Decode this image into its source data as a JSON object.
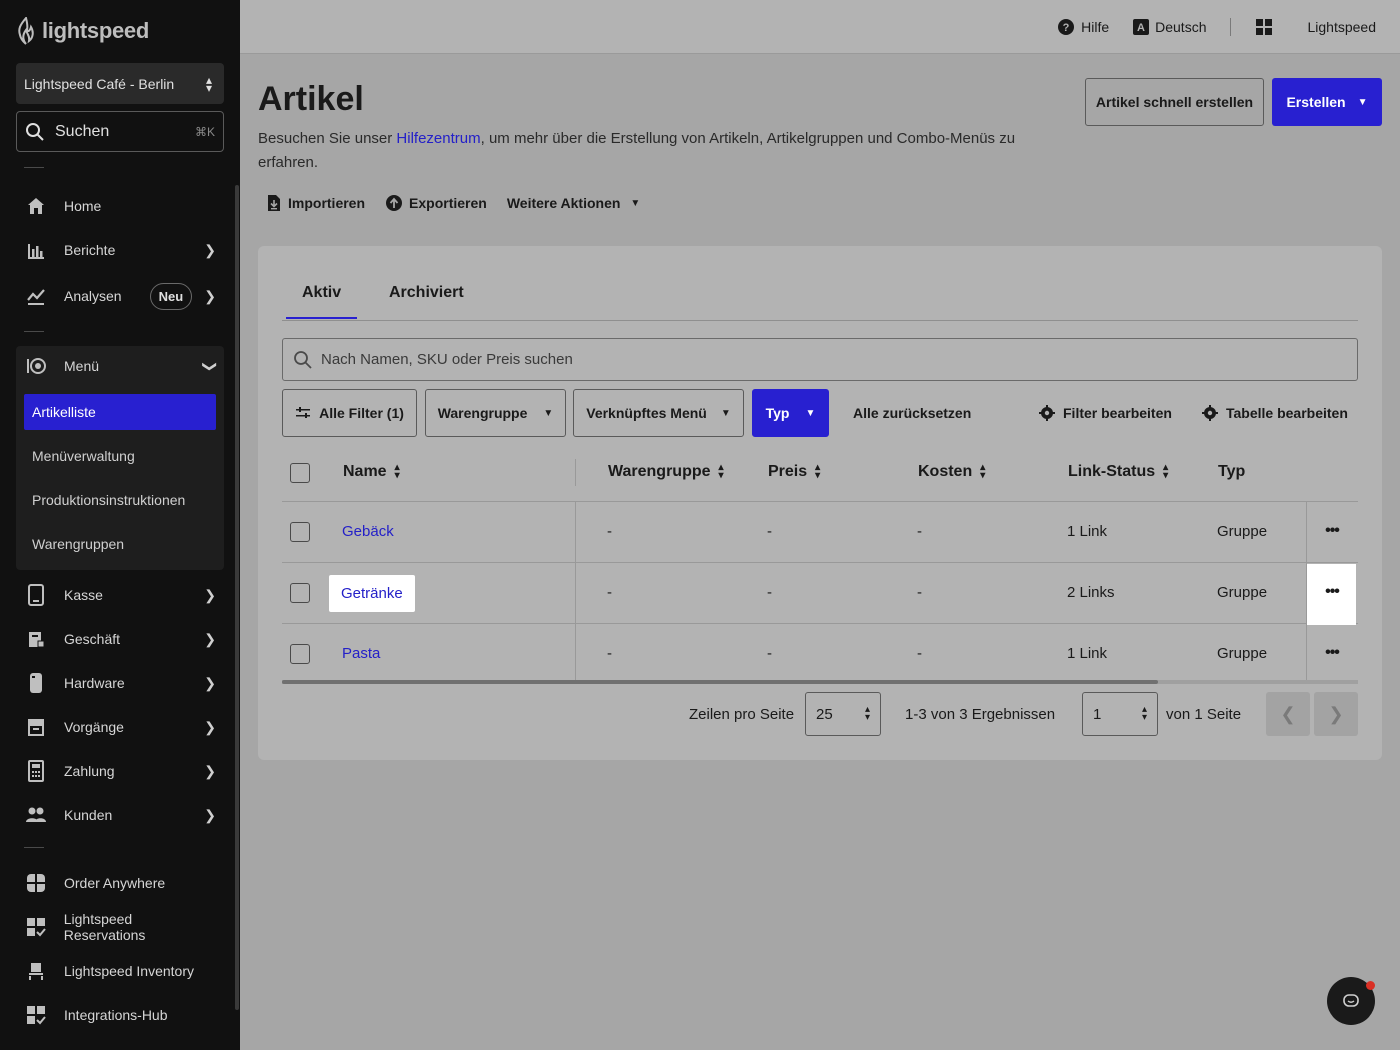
{
  "sidebar": {
    "logo": "lightspeed",
    "venue": "Lightspeed Café - Berlin",
    "search_label": "Suchen",
    "search_shortcut": "⌘K",
    "nav": {
      "home": "Home",
      "berichte": "Berichte",
      "analysen": "Analysen",
      "analysen_badge": "Neu",
      "menu": "Menü",
      "kasse": "Kasse",
      "geschaeft": "Geschäft",
      "hardware": "Hardware",
      "vorgaenge": "Vorgänge",
      "zahlung": "Zahlung",
      "kunden": "Kunden",
      "order_anywhere": "Order Anywhere",
      "reservations": "Lightspeed Reservations",
      "inventory": "Lightspeed Inventory",
      "integrations": "Integrations-Hub"
    },
    "menu_sub": [
      "Artikelliste",
      "Menüverwaltung",
      "Produktionsinstruktionen",
      "Warengruppen"
    ]
  },
  "topbar": {
    "help": "Hilfe",
    "language": "Deutsch",
    "account": "Lightspeed"
  },
  "page": {
    "title": "Artikel",
    "desc_before": "Besuchen Sie unser ",
    "desc_link": "Hilfezentrum",
    "desc_after": ", um mehr über die Erstellung von Artikeln, Artikelgruppen und Combo-Menüs zu erfahren.",
    "quick_create": "Artikel schnell erstellen",
    "create": "Erstellen",
    "import": "Importieren",
    "export": "Exportieren",
    "more_actions": "Weitere Aktionen"
  },
  "tabs": [
    "Aktiv",
    "Archiviert"
  ],
  "search_placeholder": "Nach Namen, SKU oder Preis suchen",
  "filters": {
    "all_filters": "Alle Filter (1)",
    "warengruppe": "Warengruppe",
    "linked_menu": "Verknüpftes Menü",
    "typ": "Typ",
    "reset": "Alle zurücksetzen",
    "edit_filters": "Filter bearbeiten",
    "edit_table": "Tabelle bearbeiten"
  },
  "table": {
    "headers": [
      "Name",
      "Warengruppe",
      "Preis",
      "Kosten",
      "Link-Status",
      "Typ"
    ],
    "rows": [
      {
        "name": "Gebäck",
        "warengruppe": "-",
        "preis": "-",
        "kosten": "-",
        "link": "1 Link",
        "typ": "Gruppe"
      },
      {
        "name": "Getränke",
        "warengruppe": "-",
        "preis": "-",
        "kosten": "-",
        "link": "2 Links",
        "typ": "Gruppe"
      },
      {
        "name": "Pasta",
        "warengruppe": "-",
        "preis": "-",
        "kosten": "-",
        "link": "1 Link",
        "typ": "Gruppe"
      }
    ],
    "more_glyph": "•••"
  },
  "pagination": {
    "rows_label": "Zeilen pro Seite",
    "rows_value": "25",
    "results": "1-3 von 3 Ergebnissen",
    "page_value": "1",
    "of_pages": "von 1 Seite"
  },
  "colors": {
    "accent": "#2820d0",
    "link": "#2420c8",
    "sidebar_bg": "#111111"
  }
}
